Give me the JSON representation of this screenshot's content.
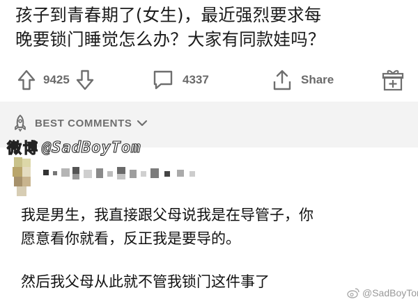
{
  "post": {
    "title_line1": "孩子到青春期了(女生)，最近强烈要求每",
    "title_line2": "晚要锁门睡觉怎么办？大家有同款娃吗？"
  },
  "actions": {
    "upvote_icon": "arrow-up-icon",
    "vote_count": "9425",
    "downvote_icon": "arrow-down-icon",
    "comment_icon": "speech-bubble-icon",
    "comment_count": "4337",
    "share_icon": "share-icon",
    "share_label": "Share",
    "award_icon": "gift-icon"
  },
  "comments_header": {
    "icon": "rocket-icon",
    "sort_label": "BEST COMMENTS",
    "dropdown_icon": "chevron-down-icon"
  },
  "watermark": {
    "weibo": "微博",
    "handle": "@SadBoyTom",
    "corner_text": "@SadBoyTom"
  },
  "comment": {
    "line1": "我是男生，我直接跟父母说我是在导管子，你",
    "line2": "愿意看你就看，反正我是要导的。",
    "line3": "然后我父母从此就不管我锁门这件事了"
  },
  "colors": {
    "icon_gray": "#6e6e6e",
    "band_gray": "#f3f3f3",
    "text": "#111111"
  }
}
